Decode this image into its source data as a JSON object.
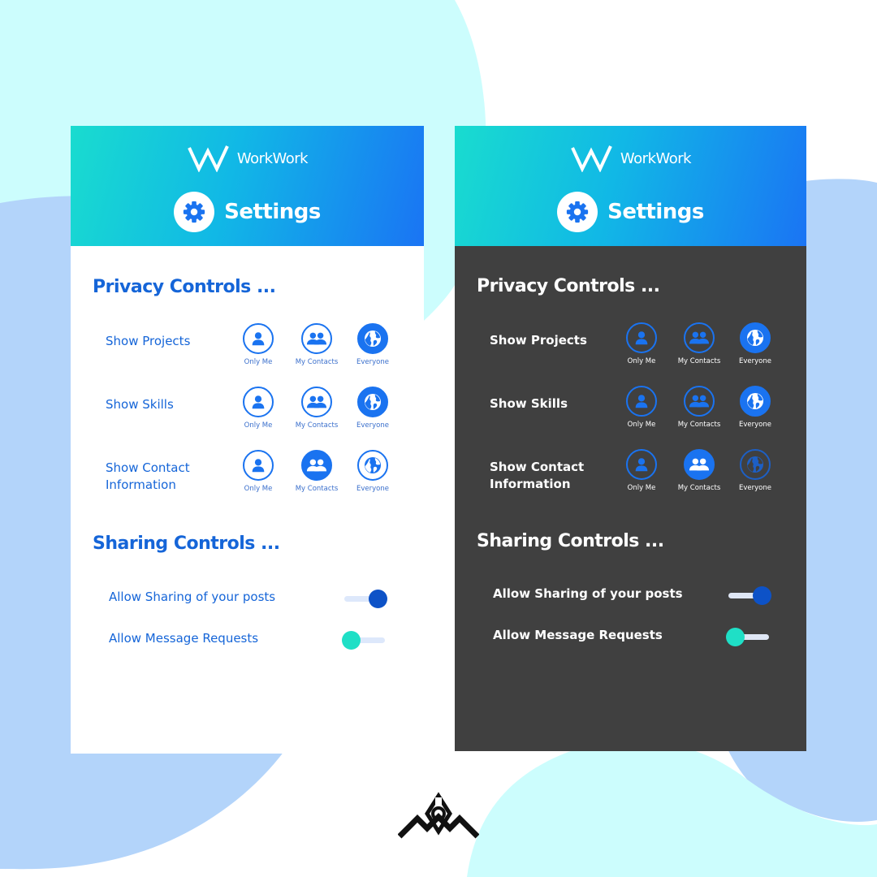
{
  "colors": {
    "accent_blue": "#1a73f0",
    "title_blue": "#1565d8",
    "teal": "#1fdfc6",
    "dark_surface": "#404040",
    "bg_light_cyan": "#ccfdfd",
    "bg_light_blue": "#b3d4fa"
  },
  "header": {
    "brand_name": "WorkWork",
    "title": "Settings",
    "icons": [
      "workwork-logo-icon",
      "gear-icon"
    ]
  },
  "privacy": {
    "title": "Privacy Controls ...",
    "options": [
      "Only Me",
      "My Contacts",
      "Everyone"
    ],
    "option_icons": [
      "person-icon",
      "group-icon",
      "globe-icon"
    ],
    "rows": [
      {
        "label_line1": "Show Projects",
        "label_line2": "",
        "selected": "Everyone"
      },
      {
        "label_line1": "Show Skills",
        "label_line2": "",
        "selected": "Everyone"
      },
      {
        "label_line1": "Show Contact",
        "label_line2": "Information",
        "selected": "My Contacts"
      }
    ]
  },
  "sharing": {
    "title": "Sharing Controls ...",
    "items": [
      {
        "label": "Allow Sharing of your posts",
        "enabled": true
      },
      {
        "label": "Allow Message Requests",
        "enabled": false
      }
    ]
  },
  "variants": [
    "light",
    "dark"
  ]
}
